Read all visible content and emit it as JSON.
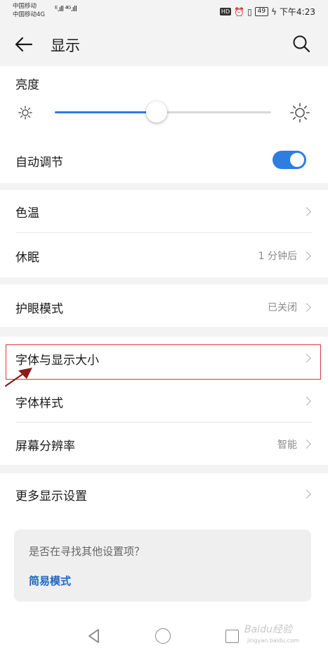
{
  "status_bar": {
    "carrier_1": "中国移动",
    "carrier_2": "中国移动4G",
    "signal_text": "ᴱ.ıll ⁴ᴳ.ıll",
    "hd_badge": "HD",
    "battery": "49",
    "time": "下午4:23"
  },
  "header": {
    "title": "显示"
  },
  "brightness": {
    "label": "亮度",
    "level": 0.47
  },
  "auto_adjust": {
    "label": "自动调节",
    "enabled": true
  },
  "rows": {
    "color_temp": {
      "label": "色温"
    },
    "sleep": {
      "label": "休眠",
      "value": "1 分钟后"
    },
    "eye_mode": {
      "label": "护眼模式",
      "value": "已关闭"
    },
    "font_display_size": {
      "label": "字体与显示大小"
    },
    "font_style": {
      "label": "字体样式"
    },
    "resolution": {
      "label": "屏幕分辨率",
      "value": "智能"
    },
    "more_display": {
      "label": "更多显示设置"
    }
  },
  "tip": {
    "question": "是否在寻找其他设置项？",
    "link": "简易模式"
  },
  "watermark": {
    "brand": "Baidu经验",
    "sub": "jingyan.baidu.com"
  },
  "colors": {
    "accent": "#2e7de1",
    "highlight_border": "#d23c3c",
    "arrow": "#8b1a1a",
    "link": "#1f66c2"
  }
}
